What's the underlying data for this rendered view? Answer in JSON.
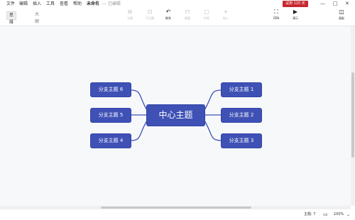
{
  "menu": {
    "file": "文件",
    "edit": "编辑",
    "insert": "插入",
    "tools": "工具",
    "view": "查看",
    "help": "帮助",
    "doc_title": "未命名",
    "doc_status": "— 已编辑"
  },
  "trial_badge": "试用 120 天",
  "window_controls": {
    "minimize": "—",
    "maximize": "□",
    "close": "✕"
  },
  "view_tabs": {
    "mindmap": "思维导图",
    "outline": "大纲"
  },
  "toolbar": {
    "topic": "主题",
    "subtopic": "子主题",
    "relation": "联系",
    "summary": "概要",
    "boundary": "外框",
    "insert": "插入",
    "zen": "ZEN",
    "present": "演示",
    "panel": "面板"
  },
  "mindmap": {
    "center": "中心主题",
    "branches": {
      "b1": "分支主题 1",
      "b2": "分支主题 2",
      "b3": "分支主题 3",
      "b4": "分支主题 4",
      "b5": "分支主题 5",
      "b6": "分支主题 6"
    }
  },
  "status": {
    "topics": "主题: 7",
    "zoom": "100%"
  },
  "colors": {
    "node": "#3f51b5",
    "trial": "#c6282f"
  }
}
